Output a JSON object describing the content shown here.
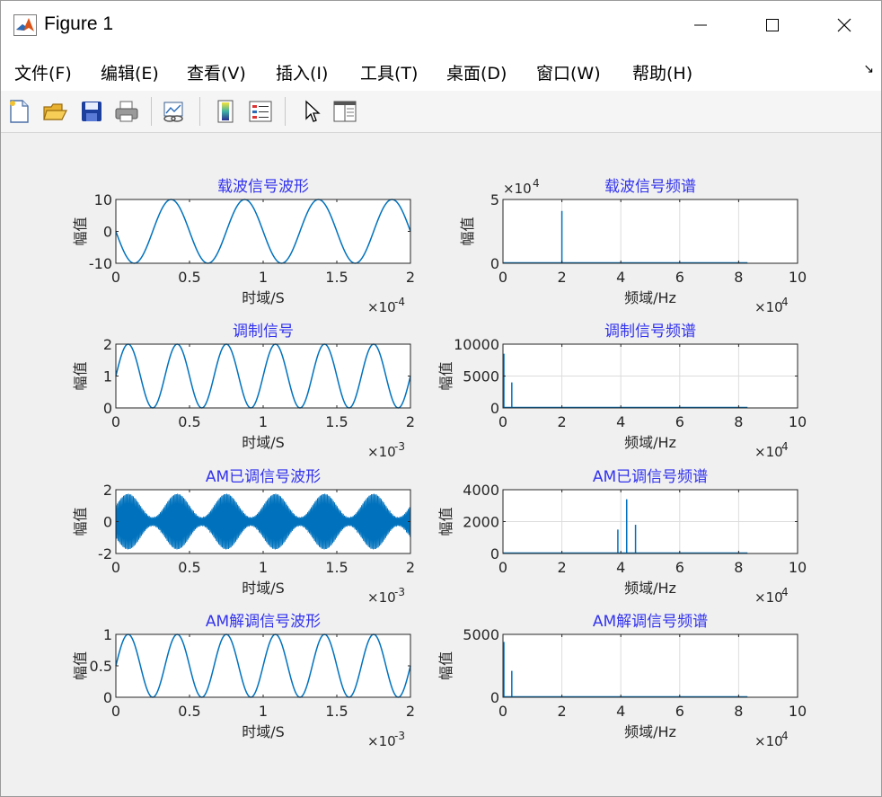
{
  "window": {
    "title": "Figure 1",
    "controls": {
      "minimize": "minimize",
      "maximize": "maximize",
      "close": "close"
    }
  },
  "menu": {
    "items": [
      {
        "label": "文件(F)"
      },
      {
        "label": "编辑(E)"
      },
      {
        "label": "查看(V)"
      },
      {
        "label": "插入(I)"
      },
      {
        "label": "工具(T)"
      },
      {
        "label": "桌面(D)"
      },
      {
        "label": "窗口(W)"
      },
      {
        "label": "帮助(H)"
      }
    ],
    "overflow_glyph": "↘"
  },
  "toolbar": {
    "buttons": [
      "new-figure-icon",
      "open-folder-icon",
      "save-icon",
      "print-icon",
      "link-plot-icon",
      "colorbar-icon",
      "legend-icon",
      "pointer-icon",
      "property-inspector-icon"
    ]
  },
  "colors": {
    "line": "#0072bd",
    "title": "#3333ee",
    "axis": "#262626",
    "grid": "#dcdcdc"
  },
  "chart_data": [
    {
      "type": "line",
      "title": "载波信号波形",
      "xlabel": "时域/S",
      "ylabel": "幅值",
      "xlim": [
        0,
        2
      ],
      "ylim": [
        -10,
        10
      ],
      "xticks": [
        "0",
        "0.5",
        "1",
        "1.5",
        "2"
      ],
      "yticks": [
        "10",
        "0",
        "-10"
      ],
      "x_exponent_label": "×10",
      "x_exponent": "-4",
      "series": [
        {
          "kind": "sine",
          "amplitude": 10,
          "offset": 0,
          "cycles": 4,
          "phase_deg": 180
        }
      ]
    },
    {
      "type": "line",
      "title": "载波信号频谱",
      "xlabel": "频域/Hz",
      "ylabel": "幅值",
      "xlim": [
        0,
        10
      ],
      "ylim": [
        0,
        5
      ],
      "xticks": [
        "0",
        "2",
        "4",
        "6",
        "8",
        "10"
      ],
      "yticks": [
        "5",
        "0"
      ],
      "x_exponent_label": "×10",
      "x_exponent": "4",
      "y_exponent_label": "×10",
      "y_exponent": "4",
      "grid": true,
      "series": [
        {
          "kind": "spectrum",
          "baseline_end": 8.3,
          "spikes": [
            {
              "x": 2,
              "y": 4.1
            }
          ]
        }
      ]
    },
    {
      "type": "line",
      "title": "调制信号",
      "xlabel": "时域/S",
      "ylabel": "幅值",
      "xlim": [
        0,
        2
      ],
      "ylim": [
        0,
        2
      ],
      "xticks": [
        "0",
        "0.5",
        "1",
        "1.5",
        "2"
      ],
      "yticks": [
        "2",
        "1",
        "0"
      ],
      "x_exponent_label": "×10",
      "x_exponent": "-3",
      "series": [
        {
          "kind": "sine",
          "amplitude": 1,
          "offset": 1,
          "cycles": 6,
          "phase_deg": 0
        }
      ]
    },
    {
      "type": "line",
      "title": "调制信号频谱",
      "xlabel": "频域/Hz",
      "ylabel": "幅值",
      "xlim": [
        0,
        10
      ],
      "ylim": [
        0,
        10000
      ],
      "xticks": [
        "0",
        "2",
        "4",
        "6",
        "8",
        "10"
      ],
      "yticks": [
        "10000",
        "5000",
        "0"
      ],
      "x_exponent_label": "×10",
      "x_exponent": "4",
      "grid": true,
      "series": [
        {
          "kind": "spectrum",
          "baseline_end": 8.3,
          "spikes": [
            {
              "x": 0,
              "y": 8500
            },
            {
              "x": 0.3,
              "y": 4000
            }
          ]
        }
      ]
    },
    {
      "type": "line",
      "title": "AM已调信号波形",
      "xlabel": "时域/S",
      "ylabel": "幅值",
      "xlim": [
        0,
        2
      ],
      "ylim": [
        -2,
        2
      ],
      "xticks": [
        "0",
        "0.5",
        "1",
        "1.5",
        "2"
      ],
      "yticks": [
        "2",
        "0",
        "-2"
      ],
      "x_exponent_label": "×10",
      "x_exponent": "-3",
      "series": [
        {
          "kind": "am",
          "envelope_cycles": 6,
          "carrier_cycles": 240,
          "offset": 1,
          "depth": 0.75
        }
      ]
    },
    {
      "type": "line",
      "title": "AM已调信号频谱",
      "xlabel": "频域/Hz",
      "ylabel": "幅值",
      "xlim": [
        0,
        10
      ],
      "ylim": [
        0,
        4000
      ],
      "xticks": [
        "0",
        "2",
        "4",
        "6",
        "8",
        "10"
      ],
      "yticks": [
        "4000",
        "2000",
        "0"
      ],
      "x_exponent_label": "×10",
      "x_exponent": "4",
      "grid": true,
      "series": [
        {
          "kind": "spectrum",
          "baseline_end": 8.3,
          "spikes": [
            {
              "x": 3.9,
              "y": 1500
            },
            {
              "x": 4.2,
              "y": 3400
            },
            {
              "x": 4.5,
              "y": 1800
            }
          ]
        }
      ]
    },
    {
      "type": "line",
      "title": "AM解调信号波形",
      "xlabel": "时域/S",
      "ylabel": "幅值",
      "xlim": [
        0,
        2
      ],
      "ylim": [
        0,
        1
      ],
      "xticks": [
        "0",
        "0.5",
        "1",
        "1.5",
        "2"
      ],
      "yticks": [
        "1",
        "0.5",
        "0"
      ],
      "x_exponent_label": "×10",
      "x_exponent": "-3",
      "series": [
        {
          "kind": "sine",
          "amplitude": 0.5,
          "offset": 0.5,
          "cycles": 6,
          "phase_deg": 0
        }
      ]
    },
    {
      "type": "line",
      "title": "AM解调信号频谱",
      "xlabel": "频域/Hz",
      "ylabel": "幅值",
      "xlim": [
        0,
        10
      ],
      "ylim": [
        0,
        5000
      ],
      "xticks": [
        "0",
        "2",
        "4",
        "6",
        "8",
        "10"
      ],
      "yticks": [
        "5000",
        "0"
      ],
      "x_exponent_label": "×10",
      "x_exponent": "4",
      "grid": true,
      "series": [
        {
          "kind": "spectrum",
          "baseline_end": 8.3,
          "spikes": [
            {
              "x": 0,
              "y": 4400
            },
            {
              "x": 0.3,
              "y": 2100
            }
          ]
        }
      ]
    }
  ]
}
